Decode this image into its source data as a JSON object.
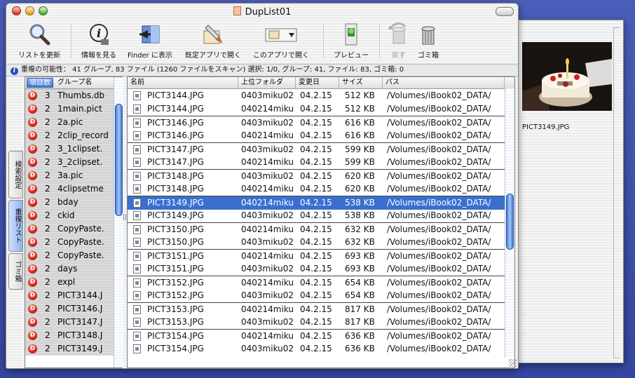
{
  "window": {
    "title": "DupList01"
  },
  "toolbar": {
    "refresh": "リストを更新",
    "info": "情報を見る",
    "finder": "Finder に表示",
    "default_app": "既定アプリで開く",
    "this_app": "このアプリで開く",
    "preview": "プレビュー",
    "undo": "戻す",
    "trash": "ゴミ箱"
  },
  "status": {
    "text": "重複の可能性： 41 グループ, 83 ファイル (1260 ファイルをスキャン)  選択: 1/0, グループ: 41, ファイル: 83, ゴミ箱: 0"
  },
  "tabs": {
    "search": "検索設定",
    "dup": "重複リスト",
    "trash": "ゴミ箱"
  },
  "groups": {
    "col_count": "項目数",
    "col_name": "グループ名",
    "rows": [
      {
        "badge": "D",
        "count": "3",
        "name": "Thumbs.db"
      },
      {
        "badge": "D",
        "count": "2",
        "name": "1main.pict"
      },
      {
        "badge": "D",
        "count": "2",
        "name": "2a.pic"
      },
      {
        "badge": "D",
        "count": "2",
        "name": "2clip_record"
      },
      {
        "badge": "D",
        "count": "2",
        "name": "3_1clipset."
      },
      {
        "badge": "D",
        "count": "2",
        "name": "3_2clipset."
      },
      {
        "badge": "D",
        "count": "2",
        "name": "3a.pic"
      },
      {
        "badge": "D",
        "count": "2",
        "name": "4clipsetme"
      },
      {
        "badge": "D",
        "count": "2",
        "name": "bday"
      },
      {
        "badge": "D",
        "count": "2",
        "name": "ckid"
      },
      {
        "badge": "D",
        "count": "2",
        "name": "CopyPaste."
      },
      {
        "badge": "D",
        "count": "2",
        "name": "CopyPaste."
      },
      {
        "badge": "D",
        "count": "2",
        "name": "CopyPaste."
      },
      {
        "badge": "D",
        "count": "2",
        "name": "days"
      },
      {
        "badge": "D",
        "count": "2",
        "name": "expl"
      },
      {
        "badge": "D",
        "count": "2",
        "name": "PICT3144.J"
      },
      {
        "badge": "D",
        "count": "2",
        "name": "PICT3146.J"
      },
      {
        "badge": "D",
        "count": "2",
        "name": "PICT3147.J"
      },
      {
        "badge": "D",
        "count": "2",
        "name": "PICT3148.J"
      },
      {
        "badge": "D",
        "count": "2",
        "name": "PICT3149.J"
      }
    ]
  },
  "files": {
    "columns": {
      "name": "名前",
      "folder": "上位フォルダ",
      "date": "変更日",
      "size": "サイズ",
      "path": "パス"
    },
    "rows": [
      {
        "name": "PICT3144.JPG",
        "folder": "0403miku02",
        "date": "04.2.15",
        "size": "512 KB",
        "path": "/Volumes/iBook02_DATA/",
        "sep": false
      },
      {
        "name": "PICT3144.JPG",
        "folder": "040214miku",
        "date": "04.2.15",
        "size": "512 KB",
        "path": "/Volumes/iBook02_DATA/",
        "sep": false
      },
      {
        "name": "PICT3146.JPG",
        "folder": "0403miku02",
        "date": "04.2.15",
        "size": "616 KB",
        "path": "/Volumes/iBook02_DATA/",
        "sep": true
      },
      {
        "name": "PICT3146.JPG",
        "folder": "040214miku",
        "date": "04.2.15",
        "size": "616 KB",
        "path": "/Volumes/iBook02_DATA/",
        "sep": false
      },
      {
        "name": "PICT3147.JPG",
        "folder": "0403miku02",
        "date": "04.2.15",
        "size": "599 KB",
        "path": "/Volumes/iBook02_DATA/",
        "sep": true
      },
      {
        "name": "PICT3147.JPG",
        "folder": "040214miku",
        "date": "04.2.15",
        "size": "599 KB",
        "path": "/Volumes/iBook02_DATA/",
        "sep": false
      },
      {
        "name": "PICT3148.JPG",
        "folder": "0403miku02",
        "date": "04.2.15",
        "size": "620 KB",
        "path": "/Volumes/iBook02_DATA/",
        "sep": true
      },
      {
        "name": "PICT3148.JPG",
        "folder": "040214miku",
        "date": "04.2.15",
        "size": "620 KB",
        "path": "/Volumes/iBook02_DATA/",
        "sep": false
      },
      {
        "name": "PICT3149.JPG",
        "folder": "040214miku",
        "date": "04.2.15",
        "size": "538 KB",
        "path": "/Volumes/iBook02_DATA/",
        "sep": true,
        "selected": true
      },
      {
        "name": "PICT3149.JPG",
        "folder": "0403miku02",
        "date": "04.2.15",
        "size": "538 KB",
        "path": "/Volumes/iBook02_DATA/",
        "sep": false
      },
      {
        "name": "PICT3150.JPG",
        "folder": "040214miku",
        "date": "04.2.15",
        "size": "632 KB",
        "path": "/Volumes/iBook02_DATA/",
        "sep": true
      },
      {
        "name": "PICT3150.JPG",
        "folder": "0403miku02",
        "date": "04.2.15",
        "size": "632 KB",
        "path": "/Volumes/iBook02_DATA/",
        "sep": false
      },
      {
        "name": "PICT3151.JPG",
        "folder": "040214miku",
        "date": "04.2.15",
        "size": "693 KB",
        "path": "/Volumes/iBook02_DATA/",
        "sep": true
      },
      {
        "name": "PICT3151.JPG",
        "folder": "0403miku02",
        "date": "04.2.15",
        "size": "693 KB",
        "path": "/Volumes/iBook02_DATA/",
        "sep": false
      },
      {
        "name": "PICT3152.JPG",
        "folder": "040214miku",
        "date": "04.2.15",
        "size": "654 KB",
        "path": "/Volumes/iBook02_DATA/",
        "sep": true
      },
      {
        "name": "PICT3152.JPG",
        "folder": "0403miku02",
        "date": "04.2.15",
        "size": "654 KB",
        "path": "/Volumes/iBook02_DATA/",
        "sep": false
      },
      {
        "name": "PICT3153.JPG",
        "folder": "040214miku",
        "date": "04.2.15",
        "size": "817 KB",
        "path": "/Volumes/iBook02_DATA/",
        "sep": true
      },
      {
        "name": "PICT3153.JPG",
        "folder": "0403miku02",
        "date": "04.2.15",
        "size": "817 KB",
        "path": "/Volumes/iBook02_DATA/",
        "sep": false
      },
      {
        "name": "PICT3154.JPG",
        "folder": "040214miku",
        "date": "04.2.15",
        "size": "636 KB",
        "path": "/Volumes/iBook02_DATA/",
        "sep": true
      },
      {
        "name": "PICT3154.JPG",
        "folder": "0403miku02",
        "date": "04.2.15",
        "size": "636 KB",
        "path": "/Volumes/iBook02_DATA/",
        "sep": false
      }
    ]
  },
  "preview": {
    "caption": "PICT3149.JPG"
  },
  "colors": {
    "selection": "#3a6fcf",
    "badge": "#c21c10",
    "desktop": "#3d4fa3"
  }
}
